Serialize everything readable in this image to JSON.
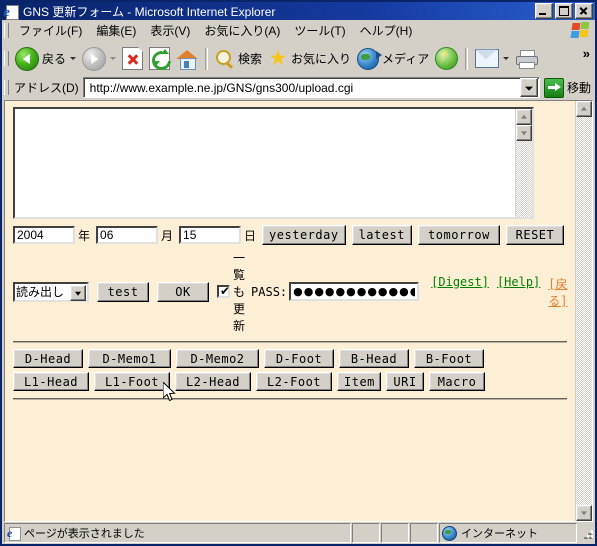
{
  "window": {
    "title": "GNS 更新フォーム - Microsoft Internet Explorer",
    "icon": "ie-page-icon",
    "buttons": {
      "minimize": "_",
      "maximize": "□",
      "close": "✕"
    }
  },
  "menubar": {
    "items": [
      {
        "label": "ファイル(F)",
        "name": "menu-file"
      },
      {
        "label": "編集(E)",
        "name": "menu-edit"
      },
      {
        "label": "表示(V)",
        "name": "menu-view"
      },
      {
        "label": "お気に入り(A)",
        "name": "menu-favorites"
      },
      {
        "label": "ツール(T)",
        "name": "menu-tools"
      },
      {
        "label": "ヘルプ(H)",
        "name": "menu-help"
      }
    ]
  },
  "toolbar": {
    "back_label": "戻る",
    "search_label": "検索",
    "favorites_label": "お気に入り",
    "media_label": "メディア",
    "overflow_label": "»"
  },
  "addressbar": {
    "label": "アドレス(D)",
    "url": "http://www.example.ne.jp/GNS/gns300/upload.cgi",
    "go_label": "移動"
  },
  "page": {
    "textarea_value": "",
    "date": {
      "year": "2004",
      "year_unit": "年",
      "month": "06",
      "month_unit": "月",
      "day": "15",
      "day_unit": "日"
    },
    "date_buttons": [
      {
        "label": "yesterday",
        "name": "yesterday-button"
      },
      {
        "label": "latest",
        "name": "latest-button"
      },
      {
        "label": "tomorrow",
        "name": "tomorrow-button"
      },
      {
        "label": "RESET",
        "name": "reset-button"
      }
    ],
    "mode_select": {
      "selected": "読み出し",
      "options": [
        "読み出し"
      ]
    },
    "test_button": "test",
    "ok_button": "OK",
    "checkbox": {
      "label": "一覧も更新",
      "checked": true,
      "tick": "✔"
    },
    "pass_label": "PASS:",
    "pass_value": "●●●●●●●●●●●●",
    "links": [
      {
        "label": "[Digest]",
        "color": "#008000",
        "name": "digest-link"
      },
      {
        "label": "[Help]",
        "color": "#008000",
        "name": "help-link"
      },
      {
        "label": "[戻る]",
        "color": "#e08030",
        "name": "back-link"
      }
    ],
    "section_buttons_row1": [
      {
        "label": "D-Head",
        "name": "d-head-button"
      },
      {
        "label": "D-Memo1",
        "name": "d-memo1-button"
      },
      {
        "label": "D-Memo2",
        "name": "d-memo2-button"
      },
      {
        "label": "D-Foot",
        "name": "d-foot-button"
      },
      {
        "label": "B-Head",
        "name": "b-head-button"
      },
      {
        "label": "B-Foot",
        "name": "b-foot-button"
      }
    ],
    "section_buttons_row2": [
      {
        "label": "L1-Head",
        "name": "l1-head-button"
      },
      {
        "label": "L1-Foot",
        "name": "l1-foot-button"
      },
      {
        "label": "L2-Head",
        "name": "l2-head-button"
      },
      {
        "label": "L2-Foot",
        "name": "l2-foot-button"
      },
      {
        "label": "Item",
        "name": "item-button"
      },
      {
        "label": "URI",
        "name": "uri-button"
      },
      {
        "label": "Macro",
        "name": "macro-button"
      }
    ],
    "background_color": "#fdefd5"
  },
  "statusbar": {
    "message": "ページが表示されました",
    "zone": "インターネット"
  }
}
